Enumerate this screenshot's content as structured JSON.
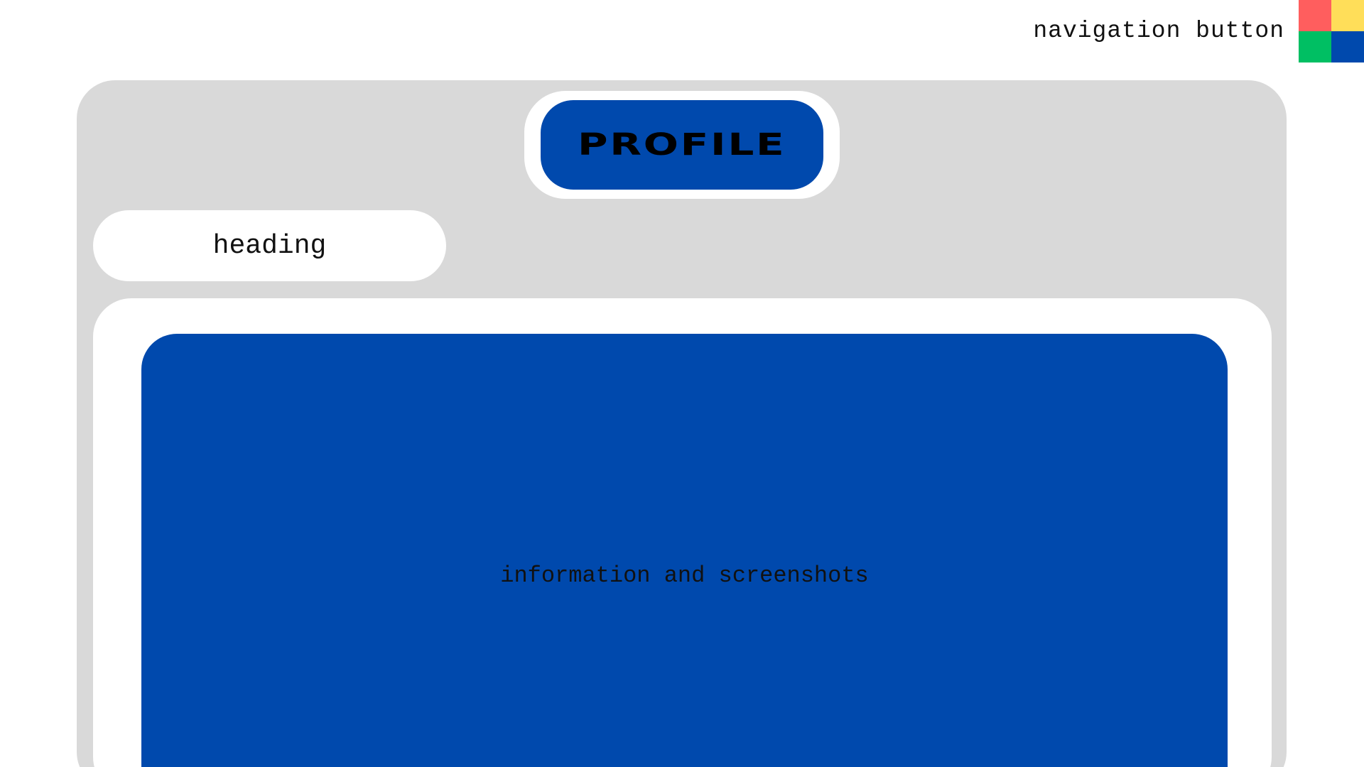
{
  "colors": {
    "accent_blue": "#0049ad",
    "panel_gray": "#d9d9d9",
    "nav_red": "#ff5e5e",
    "nav_yellow": "#ffde59",
    "nav_green": "#00bf63",
    "nav_blue": "#0049ad"
  },
  "nav": {
    "label": "navigation button",
    "icon": "four-color-grid-icon"
  },
  "profile": {
    "title": "PROFILE"
  },
  "heading": {
    "label": "heading"
  },
  "content": {
    "text": "information and screenshots"
  }
}
